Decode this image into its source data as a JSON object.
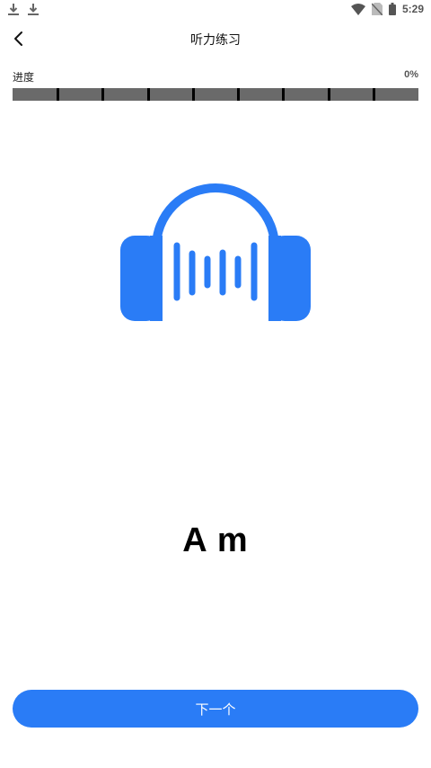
{
  "status_bar": {
    "time": "5:29",
    "icons": [
      "download-icon",
      "download-icon",
      "wifi-icon",
      "no-sim-icon",
      "battery-icon"
    ]
  },
  "header": {
    "title": "听力练习",
    "back_icon": "chevron-left-icon"
  },
  "progress": {
    "label": "进度",
    "value_text": "0%",
    "value": 0,
    "segments": 9
  },
  "illustration": {
    "icon": "headphones-audio-icon",
    "color": "#2a7cf6"
  },
  "chord": {
    "text": "A m"
  },
  "next_button": {
    "label": "下一个",
    "color": "#2a7cf6"
  }
}
